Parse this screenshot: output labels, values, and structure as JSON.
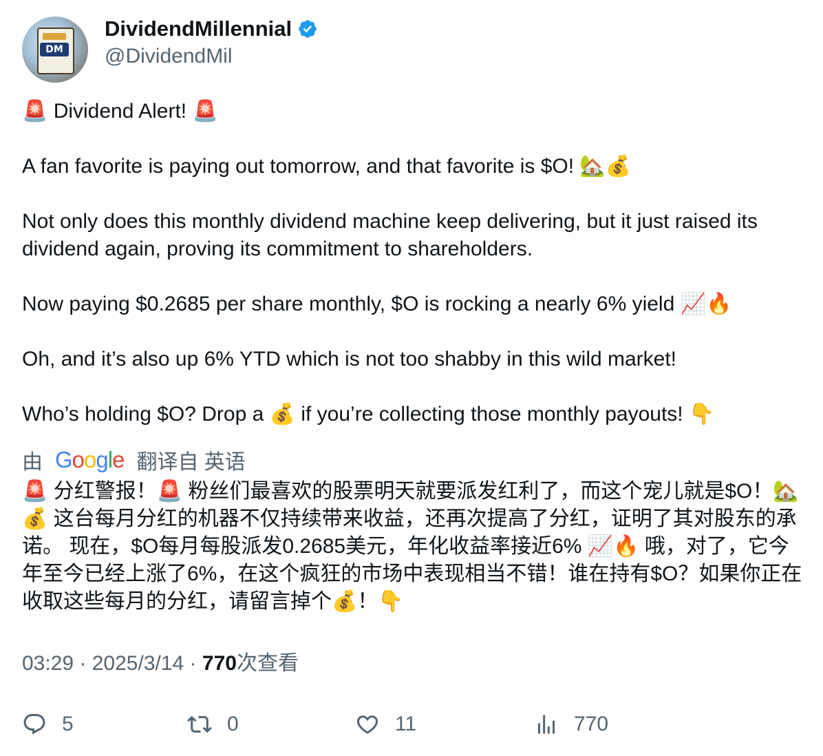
{
  "author": {
    "display_name": "DividendMillennial",
    "handle": "@DividendMil",
    "avatar_text": "DM",
    "verified_color": "#1d9bf0"
  },
  "post": {
    "paragraphs": [
      "🚨 Dividend Alert! 🚨",
      "A fan favorite is paying out tomorrow, and that favorite is $O! 🏡💰",
      "Not only does this monthly dividend machine keep delivering, but it just raised its dividend again, proving its commitment to shareholders.",
      "Now paying $0.2685 per share monthly, $O is rocking a nearly 6% yield 📈🔥",
      "Oh, and it’s also up 6% YTD which is not too shabby in this wild market!",
      "Who’s holding $O? Drop a 💰 if you’re collecting those monthly payouts! 👇"
    ]
  },
  "translation": {
    "prefix": "由",
    "suffix": "翻译自 英语",
    "text": "🚨 分红警报！🚨 粉丝们最喜欢的股票明天就要派发红利了，而这个宠儿就是$O！🏡💰 这台每月分红的机器不仅持续带来收益，还再次提高了分红，证明了其对股东的承诺。 现在，$O每月每股派发0.2685美元，年化收益率接近6% 📈🔥 哦，对了，它今年至今已经上涨了6%，在这个疯狂的市场中表现相当不错！谁在持有$O？如果你正在收取这些每月的分红，请留言掉个💰！👇"
  },
  "meta": {
    "time": "03:29",
    "separator": " · ",
    "date": "2025/3/14",
    "views_count": "770",
    "views_label": "次查看"
  },
  "actions": {
    "replies": "5",
    "reposts": "0",
    "likes": "11",
    "views": "770"
  },
  "colors": {
    "text": "#0f1419",
    "secondary": "#536471",
    "verified": "#1d9bf0"
  }
}
